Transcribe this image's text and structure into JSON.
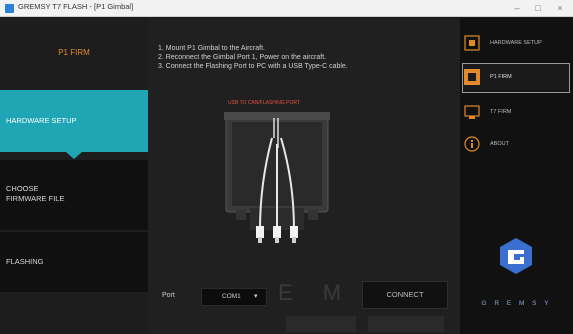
{
  "window": {
    "title": "GREMSY T7 FLASH - [P1 Gimbal]",
    "minimize": "–",
    "maximize": "□",
    "close": "×"
  },
  "left": {
    "title": "P1 FIRM",
    "steps": [
      {
        "label": "HARDWARE SETUP"
      },
      {
        "label_line1": "CHOOSE",
        "label_line2": "FIRMWARE FILE"
      },
      {
        "label": "FLASHING"
      }
    ]
  },
  "main": {
    "instructions": [
      "1. Mount P1 Gimbal to the Aircraft.",
      "2. Reconnect the Gimbal Port 1, Power on the aircraft.",
      "3. Connect the Flashing Port to PC with a USB Type-C cable."
    ],
    "device_label": "USB TO CAN/FLASHING PORT",
    "port": {
      "label": "Port",
      "value": "COM1",
      "chevron": "▾"
    },
    "connect_label": "CONNECT",
    "background_letters": "E M S"
  },
  "right": {
    "nav": [
      {
        "label": "HARDWARE SETUP"
      },
      {
        "label": "P1 FIRM"
      },
      {
        "label": "T7 FIRM"
      },
      {
        "label": "ABOUT"
      }
    ],
    "brand": "G R E M S Y"
  },
  "colors": {
    "accent": "#20a5b4",
    "orange": "#e08a2c",
    "brand_blue": "#3a6fd0",
    "red": "#e2503c"
  }
}
